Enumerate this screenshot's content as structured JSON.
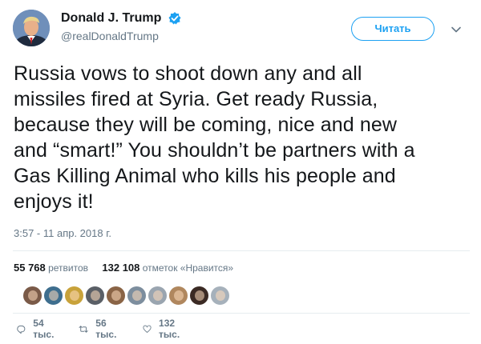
{
  "author": {
    "display_name": "Donald J. Trump",
    "handle": "@realDonaldTrump",
    "verified": true,
    "verified_color": "#1da1f2"
  },
  "follow_button": {
    "label": "Читать"
  },
  "tweet": {
    "text": "Russia vows to shoot down any and all\nmissiles fired at Syria. Get ready Russia,\nbecause they will be coming, nice and new\nand “smart!” You shouldn’t be partners with a\nGas Killing Animal who kills his people and\nenjoys it!",
    "timestamp": "3:57 - 11 апр. 2018 г."
  },
  "stats": {
    "retweets_count": "55 768",
    "retweets_label": "ретвитов",
    "likes_count": "132 108",
    "likes_label": "отметок «Нравится»"
  },
  "likers": [
    {
      "color": "#7a5a48"
    },
    {
      "color": "#3e6e8e"
    },
    {
      "color": "#c8a23a"
    },
    {
      "color": "#5a5f66"
    },
    {
      "color": "#8a6446"
    },
    {
      "color": "#7d8e9e"
    },
    {
      "color": "#9aa5b0"
    },
    {
      "color": "#b0875e"
    },
    {
      "color": "#3b2a24"
    },
    {
      "color": "#a6b1bb"
    }
  ],
  "actions": {
    "reply_count": "54 тыс.",
    "retweet_count": "56 тыс.",
    "like_count": "132 тыс."
  },
  "colors": {
    "accent": "#1da1f2",
    "muted": "#657786",
    "text": "#14171a",
    "divider": "#e6ecf0"
  }
}
